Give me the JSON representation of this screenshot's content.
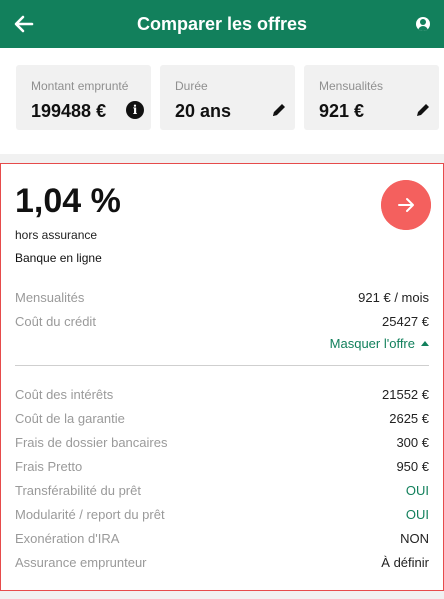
{
  "header": {
    "title": "Comparer les offres"
  },
  "summary": [
    {
      "label": "Montant emprunté",
      "value": "199488 €",
      "icon": "info-icon"
    },
    {
      "label": "Durée",
      "value": "20 ans",
      "icon": "pencil-icon"
    },
    {
      "label": "Mensualités",
      "value": "921 €",
      "icon": "pencil-icon"
    }
  ],
  "offer": {
    "rate": "1,04 %",
    "rate_note": "hors assurance",
    "bank": "Banque en ligne",
    "main_rows": [
      {
        "label": "Mensualités",
        "value": "921 € / mois"
      },
      {
        "label": "Coût du crédit",
        "value": "25427 €"
      }
    ],
    "toggle_label": "Masquer l'offre",
    "detail_rows": [
      {
        "label": "Coût des intérêts",
        "value": "21552 €"
      },
      {
        "label": "Coût de la garantie",
        "value": "2625 €"
      },
      {
        "label": "Frais de dossier bancaires",
        "value": "300 €"
      },
      {
        "label": "Frais Pretto",
        "value": "950 €"
      },
      {
        "label": "Transférabilité du prêt",
        "value": "OUI"
      },
      {
        "label": "Modularité / report du prêt",
        "value": "OUI"
      },
      {
        "label": "Exonération d'IRA",
        "value": "NON"
      },
      {
        "label": "Assurance emprunteur",
        "value": "À définir"
      }
    ]
  },
  "colors": {
    "brand": "#12805c",
    "accent": "#f4605e",
    "yes": "#12805c"
  }
}
